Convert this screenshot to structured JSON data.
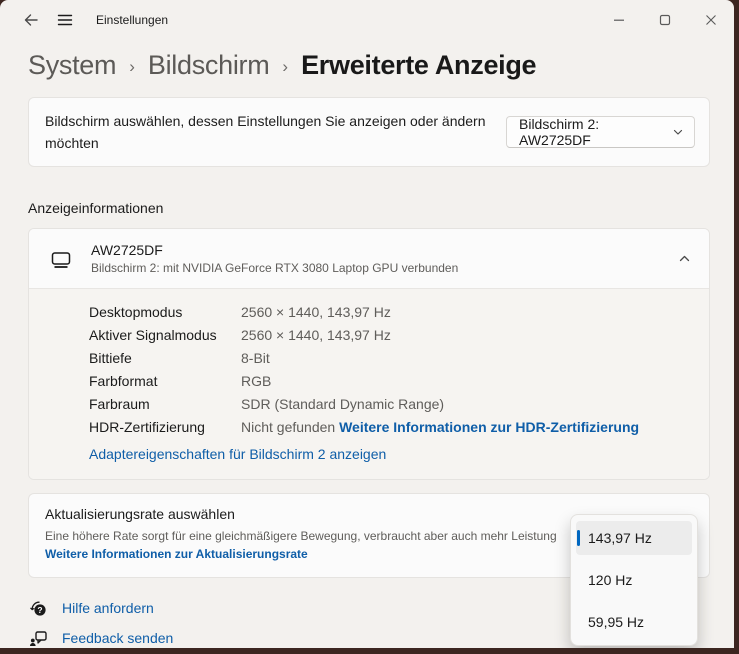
{
  "window": {
    "title": "Einstellungen"
  },
  "breadcrumb": {
    "separator": "›",
    "items": [
      "System",
      "Bildschirm",
      "Erweiterte Anzeige"
    ]
  },
  "display_select_card": {
    "label": "Bildschirm auswählen, dessen Einstellungen Sie anzeigen oder ändern möchten",
    "dropdown_value": "Bildschirm 2: AW2725DF"
  },
  "section": {
    "title": "Anzeigeinformationen"
  },
  "display_info_card": {
    "name": "AW2725DF",
    "subtitle": "Bildschirm 2: mit NVIDIA GeForce RTX 3080 Laptop GPU verbunden",
    "rows": [
      {
        "label": "Desktopmodus",
        "value": "2560 × 1440, 143,97 Hz"
      },
      {
        "label": "Aktiver Signalmodus",
        "value": "2560 × 1440, 143,97 Hz"
      },
      {
        "label": "Bittiefe",
        "value": "8-Bit"
      },
      {
        "label": "Farbformat",
        "value": "RGB"
      },
      {
        "label": "Farbraum",
        "value": "SDR (Standard Dynamic Range)"
      },
      {
        "label": "HDR-Zertifizierung",
        "value": "Nicht gefunden",
        "link": "Weitere Informationen zur HDR-Zertifizierung"
      }
    ],
    "adapter_link": "Adaptereigenschaften für Bildschirm 2 anzeigen"
  },
  "refresh_rate_card": {
    "title": "Aktualisierungsrate auswählen",
    "description": "Eine höhere Rate sorgt für eine gleichmäßigere Bewegung, verbraucht aber auch mehr Leistung",
    "link": "Weitere Informationen zur Aktualisierungsrate"
  },
  "refresh_rate_dropdown": {
    "options": [
      {
        "label": "143,97 Hz",
        "selected": true
      },
      {
        "label": "120 Hz",
        "selected": false
      },
      {
        "label": "59,95 Hz",
        "selected": false
      }
    ]
  },
  "footer_links": [
    {
      "label": "Hilfe anfordern"
    },
    {
      "label": "Feedback senden"
    }
  ],
  "colors": {
    "accent": "#0067c0",
    "link": "#0f5ea8",
    "window_background": "#f3f1ee",
    "card_background": "#fbfbfb",
    "desktop_background": "#3c2620"
  }
}
